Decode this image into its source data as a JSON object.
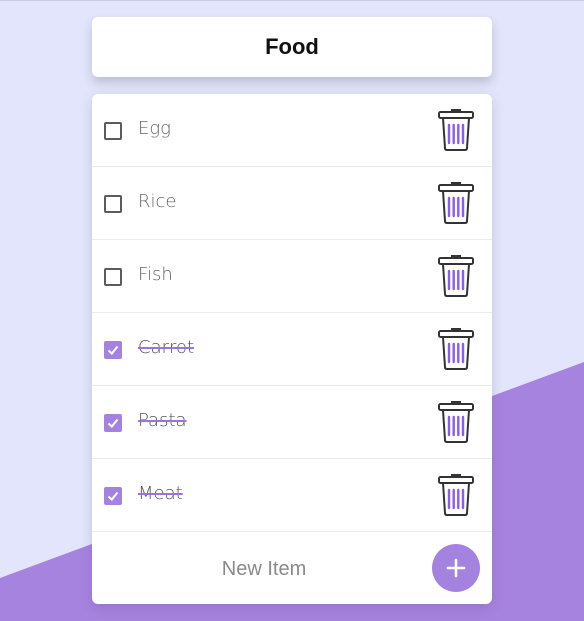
{
  "page": {
    "title": "Food",
    "new_item_placeholder": "New Item",
    "add_symbol": "+"
  },
  "items": [
    {
      "label": "Egg",
      "checked": false
    },
    {
      "label": "Rice",
      "checked": false
    },
    {
      "label": "Fish",
      "checked": false
    },
    {
      "label": "Carrot",
      "checked": true
    },
    {
      "label": "Pasta",
      "checked": true
    },
    {
      "label": "Meat",
      "checked": true
    }
  ],
  "icons": {
    "delete": "trash-icon",
    "add": "plus-icon",
    "check": "checkmark-icon"
  },
  "colors": {
    "background": "#e2e5fb",
    "accent": "#a482e0",
    "card": "#ffffff",
    "trash_stripes": "#8a5cf0"
  }
}
